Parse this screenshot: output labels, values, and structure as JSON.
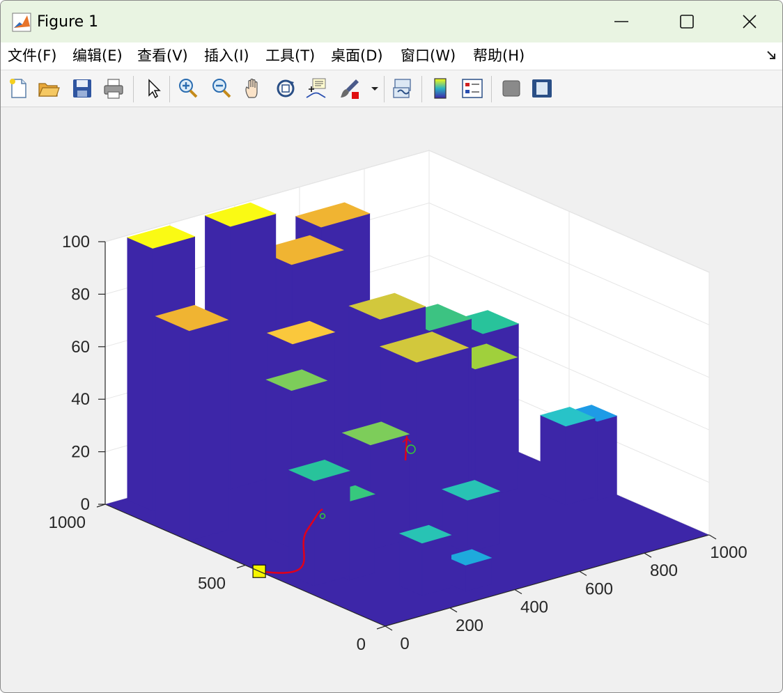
{
  "window": {
    "title": "Figure 1",
    "icon": "matlab-icon",
    "controls": [
      "minimize-icon",
      "maximize-icon",
      "close-icon"
    ]
  },
  "menubar": {
    "items": [
      {
        "label": "文件(F)",
        "mnemonic": "F"
      },
      {
        "label": "编辑(E)",
        "mnemonic": "E"
      },
      {
        "label": "查看(V)",
        "mnemonic": "V"
      },
      {
        "label": "插入(I)",
        "mnemonic": "I"
      },
      {
        "label": "工具(T)",
        "mnemonic": "T"
      },
      {
        "label": "桌面(D)",
        "mnemonic": "D"
      },
      {
        "label": "窗口(W)",
        "mnemonic": "W"
      },
      {
        "label": "帮助(H)",
        "mnemonic": "H"
      }
    ],
    "dock_icon": "dock-arrow-icon"
  },
  "toolbar": {
    "buttons": [
      "new-figure-icon",
      "open-icon",
      "save-icon",
      "print-icon",
      "select-pointer-icon",
      "zoom-in-icon",
      "zoom-out-icon",
      "pan-hand-icon",
      "rotate-3d-icon",
      "data-cursor-icon",
      "brush-icon",
      "brush-dropdown-icon",
      "link-plot-icon",
      "colorbar-icon",
      "legend-icon",
      "hide-plot-tools-icon",
      "show-plot-tools-icon"
    ]
  },
  "colors": {
    "floor": "#3d26a8",
    "wall": "#3d26a8",
    "path": "#e0001b",
    "start_marker": "#f5f500",
    "waypoint": "#33cc33",
    "grid": "#e6e6e6"
  },
  "chart_data": {
    "type": "bar3",
    "x_ticks": [
      "0",
      "200",
      "400",
      "600",
      "800",
      "1000"
    ],
    "y_ticks": [
      "0",
      "500",
      "1000"
    ],
    "z_ticks": [
      "0",
      "20",
      "40",
      "60",
      "80",
      "100"
    ],
    "xlim": [
      0,
      1000
    ],
    "ylim": [
      0,
      1000
    ],
    "zlim": [
      0,
      100
    ],
    "grid": true,
    "colormap": "parula",
    "buildings": [
      {
        "x": 0,
        "y": 700,
        "w": 120,
        "d": 120,
        "h": 80,
        "top": "#f0b432"
      },
      {
        "x": 60,
        "y": 900,
        "w": 130,
        "d": 90,
        "h": 100,
        "top": "#fafa14"
      },
      {
        "x": 300,
        "y": 900,
        "w": 140,
        "d": 90,
        "h": 100,
        "top": "#fafa14"
      },
      {
        "x": 160,
        "y": 520,
        "w": 110,
        "d": 90,
        "h": 60,
        "top": "#7dcd5a"
      },
      {
        "x": 250,
        "y": 620,
        "w": 130,
        "d": 90,
        "h": 70,
        "top": "#fac83c"
      },
      {
        "x": 420,
        "y": 820,
        "w": 160,
        "d": 120,
        "h": 85,
        "top": "#f0b432"
      },
      {
        "x": 580,
        "y": 900,
        "w": 150,
        "d": 90,
        "h": 90,
        "top": "#f0b432"
      },
      {
        "x": 520,
        "y": 620,
        "w": 140,
        "d": 110,
        "h": 70,
        "top": "#d2c83c"
      },
      {
        "x": 40,
        "y": 300,
        "w": 110,
        "d": 90,
        "h": 40,
        "top": "#28c39b"
      },
      {
        "x": 130,
        "y": 280,
        "w": 80,
        "d": 70,
        "h": 30,
        "top": "#37c87d"
      },
      {
        "x": 300,
        "y": 400,
        "w": 120,
        "d": 100,
        "h": 40,
        "top": "#7dcd5a"
      },
      {
        "x": 460,
        "y": 420,
        "w": 160,
        "d": 130,
        "h": 65,
        "top": "#d2c83c"
      },
      {
        "x": 620,
        "y": 560,
        "w": 130,
        "d": 120,
        "h": 65,
        "top": "#3cc382"
      },
      {
        "x": 710,
        "y": 500,
        "w": 130,
        "d": 110,
        "h": 50,
        "top": "#a0d03c"
      },
      {
        "x": 820,
        "y": 600,
        "w": 110,
        "d": 110,
        "h": 55,
        "top": "#28c39b"
      },
      {
        "x": 200,
        "y": 100,
        "w": 90,
        "d": 80,
        "h": 20,
        "top": "#28c3b4"
      },
      {
        "x": 300,
        "y": 60,
        "w": 80,
        "d": 70,
        "h": 10,
        "top": "#1eaadc"
      },
      {
        "x": 470,
        "y": 250,
        "w": 100,
        "d": 90,
        "h": 20,
        "top": "#28c3b4"
      },
      {
        "x": 860,
        "y": 350,
        "w": 90,
        "d": 90,
        "h": 30,
        "top": "#28c3c8"
      },
      {
        "x": 940,
        "y": 330,
        "w": 90,
        "d": 90,
        "h": 30,
        "top": "#1e9be6"
      }
    ],
    "path": {
      "start": [
        0,
        450,
        0
      ],
      "end": [
        400,
        520,
        20
      ]
    }
  }
}
